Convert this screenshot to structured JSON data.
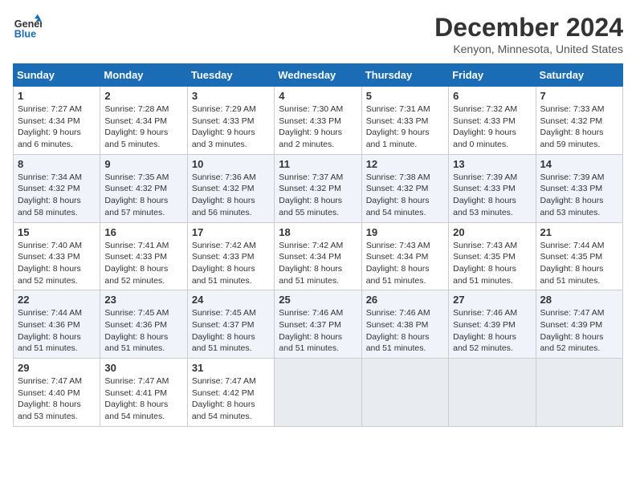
{
  "header": {
    "logo_line1": "General",
    "logo_line2": "Blue",
    "title": "December 2024",
    "subtitle": "Kenyon, Minnesota, United States"
  },
  "calendar": {
    "headers": [
      "Sunday",
      "Monday",
      "Tuesday",
      "Wednesday",
      "Thursday",
      "Friday",
      "Saturday"
    ],
    "weeks": [
      [
        {
          "day": "",
          "info": ""
        },
        {
          "day": "",
          "info": ""
        },
        {
          "day": "",
          "info": ""
        },
        {
          "day": "",
          "info": ""
        },
        {
          "day": "",
          "info": ""
        },
        {
          "day": "",
          "info": ""
        },
        {
          "day": "",
          "info": ""
        }
      ],
      [
        {
          "day": "1",
          "info": "Sunrise: 7:27 AM\nSunset: 4:34 PM\nDaylight: 9 hours and 6 minutes."
        },
        {
          "day": "2",
          "info": "Sunrise: 7:28 AM\nSunset: 4:34 PM\nDaylight: 9 hours and 5 minutes."
        },
        {
          "day": "3",
          "info": "Sunrise: 7:29 AM\nSunset: 4:33 PM\nDaylight: 9 hours and 3 minutes."
        },
        {
          "day": "4",
          "info": "Sunrise: 7:30 AM\nSunset: 4:33 PM\nDaylight: 9 hours and 2 minutes."
        },
        {
          "day": "5",
          "info": "Sunrise: 7:31 AM\nSunset: 4:33 PM\nDaylight: 9 hours and 1 minute."
        },
        {
          "day": "6",
          "info": "Sunrise: 7:32 AM\nSunset: 4:33 PM\nDaylight: 9 hours and 0 minutes."
        },
        {
          "day": "7",
          "info": "Sunrise: 7:33 AM\nSunset: 4:32 PM\nDaylight: 8 hours and 59 minutes."
        }
      ],
      [
        {
          "day": "8",
          "info": "Sunrise: 7:34 AM\nSunset: 4:32 PM\nDaylight: 8 hours and 58 minutes."
        },
        {
          "day": "9",
          "info": "Sunrise: 7:35 AM\nSunset: 4:32 PM\nDaylight: 8 hours and 57 minutes."
        },
        {
          "day": "10",
          "info": "Sunrise: 7:36 AM\nSunset: 4:32 PM\nDaylight: 8 hours and 56 minutes."
        },
        {
          "day": "11",
          "info": "Sunrise: 7:37 AM\nSunset: 4:32 PM\nDaylight: 8 hours and 55 minutes."
        },
        {
          "day": "12",
          "info": "Sunrise: 7:38 AM\nSunset: 4:32 PM\nDaylight: 8 hours and 54 minutes."
        },
        {
          "day": "13",
          "info": "Sunrise: 7:39 AM\nSunset: 4:33 PM\nDaylight: 8 hours and 53 minutes."
        },
        {
          "day": "14",
          "info": "Sunrise: 7:39 AM\nSunset: 4:33 PM\nDaylight: 8 hours and 53 minutes."
        }
      ],
      [
        {
          "day": "15",
          "info": "Sunrise: 7:40 AM\nSunset: 4:33 PM\nDaylight: 8 hours and 52 minutes."
        },
        {
          "day": "16",
          "info": "Sunrise: 7:41 AM\nSunset: 4:33 PM\nDaylight: 8 hours and 52 minutes."
        },
        {
          "day": "17",
          "info": "Sunrise: 7:42 AM\nSunset: 4:33 PM\nDaylight: 8 hours and 51 minutes."
        },
        {
          "day": "18",
          "info": "Sunrise: 7:42 AM\nSunset: 4:34 PM\nDaylight: 8 hours and 51 minutes."
        },
        {
          "day": "19",
          "info": "Sunrise: 7:43 AM\nSunset: 4:34 PM\nDaylight: 8 hours and 51 minutes."
        },
        {
          "day": "20",
          "info": "Sunrise: 7:43 AM\nSunset: 4:35 PM\nDaylight: 8 hours and 51 minutes."
        },
        {
          "day": "21",
          "info": "Sunrise: 7:44 AM\nSunset: 4:35 PM\nDaylight: 8 hours and 51 minutes."
        }
      ],
      [
        {
          "day": "22",
          "info": "Sunrise: 7:44 AM\nSunset: 4:36 PM\nDaylight: 8 hours and 51 minutes."
        },
        {
          "day": "23",
          "info": "Sunrise: 7:45 AM\nSunset: 4:36 PM\nDaylight: 8 hours and 51 minutes."
        },
        {
          "day": "24",
          "info": "Sunrise: 7:45 AM\nSunset: 4:37 PM\nDaylight: 8 hours and 51 minutes."
        },
        {
          "day": "25",
          "info": "Sunrise: 7:46 AM\nSunset: 4:37 PM\nDaylight: 8 hours and 51 minutes."
        },
        {
          "day": "26",
          "info": "Sunrise: 7:46 AM\nSunset: 4:38 PM\nDaylight: 8 hours and 51 minutes."
        },
        {
          "day": "27",
          "info": "Sunrise: 7:46 AM\nSunset: 4:39 PM\nDaylight: 8 hours and 52 minutes."
        },
        {
          "day": "28",
          "info": "Sunrise: 7:47 AM\nSunset: 4:39 PM\nDaylight: 8 hours and 52 minutes."
        }
      ],
      [
        {
          "day": "29",
          "info": "Sunrise: 7:47 AM\nSunset: 4:40 PM\nDaylight: 8 hours and 53 minutes."
        },
        {
          "day": "30",
          "info": "Sunrise: 7:47 AM\nSunset: 4:41 PM\nDaylight: 8 hours and 54 minutes."
        },
        {
          "day": "31",
          "info": "Sunrise: 7:47 AM\nSunset: 4:42 PM\nDaylight: 8 hours and 54 minutes."
        },
        {
          "day": "",
          "info": ""
        },
        {
          "day": "",
          "info": ""
        },
        {
          "day": "",
          "info": ""
        },
        {
          "day": "",
          "info": ""
        }
      ]
    ]
  }
}
